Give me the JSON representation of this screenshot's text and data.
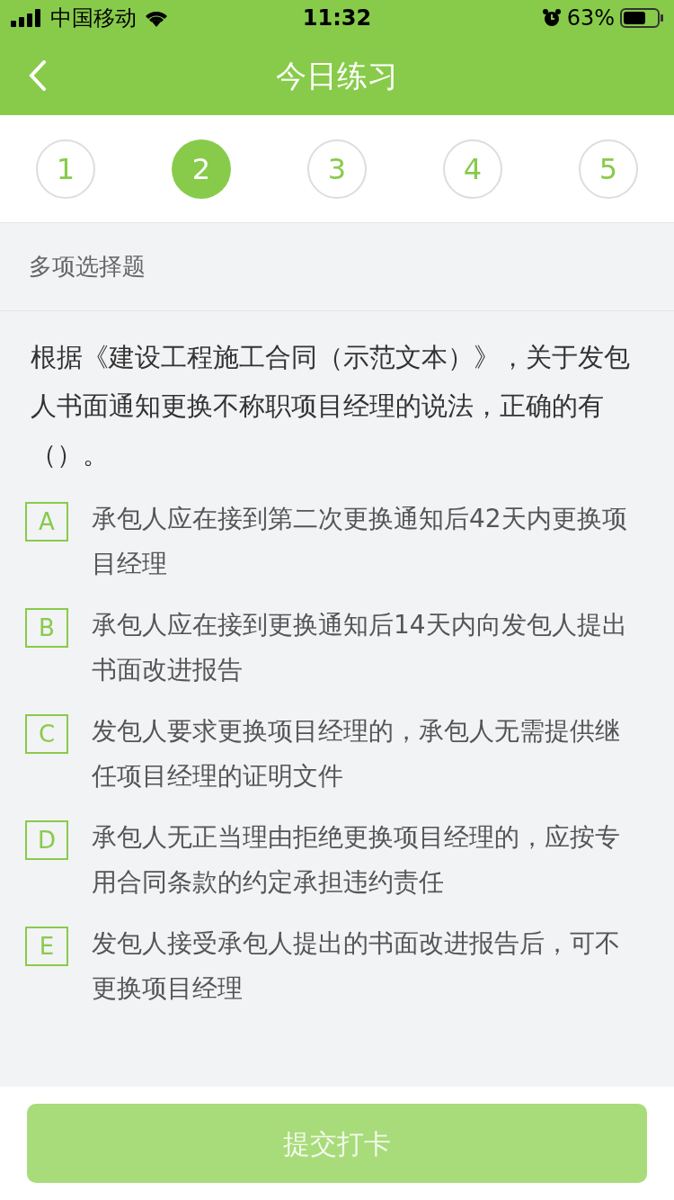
{
  "status_bar": {
    "carrier": "中国移动",
    "time": "11:32",
    "battery": "63%"
  },
  "nav": {
    "title": "今日练习"
  },
  "steps": [
    {
      "label": "1",
      "selected": false
    },
    {
      "label": "2",
      "selected": true
    },
    {
      "label": "3",
      "selected": false
    },
    {
      "label": "4",
      "selected": false
    },
    {
      "label": "5",
      "selected": false
    }
  ],
  "question_type": "多项选择题",
  "question": "根据《建设工程施工合同（示范文本）》，关于发包人书面通知更换不称职项目经理的说法，正确的有（）。",
  "options": [
    {
      "letter": "A",
      "text": "承包人应在接到第二次更换通知后42天内更换项目经理",
      "selected": false
    },
    {
      "letter": "B",
      "text": "承包人应在接到更换通知后14天内向发包人提出书面改进报告",
      "selected": false
    },
    {
      "letter": "C",
      "text": "发包人要求更换项目经理的，承包人无需提供继任项目经理的证明文件",
      "selected": false
    },
    {
      "letter": "D",
      "text": "承包人无正当理由拒绝更换项目经理的，应按专用合同条款的约定承担违约责任",
      "selected": false
    },
    {
      "letter": "E",
      "text": "发包人接受承包人提出的书面改进报告后，可不更换项目经理",
      "selected": false
    }
  ],
  "submit": {
    "label": "提交打卡",
    "disabled": true
  }
}
